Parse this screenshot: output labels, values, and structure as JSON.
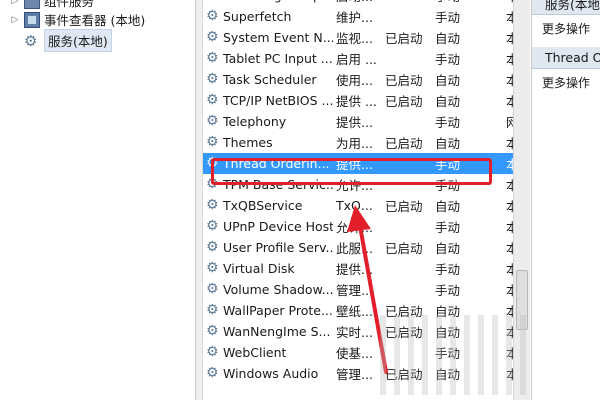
{
  "tree": {
    "items": [
      {
        "label": "组件服务"
      },
      {
        "label": "事件查看器 (本地)"
      },
      {
        "label": "服务(本地)"
      }
    ]
  },
  "services": [
    {
      "name": "Still Image Acqui...",
      "desc": "启动...",
      "status": "",
      "startup": "手动",
      "logon": "本"
    },
    {
      "name": "Superfetch",
      "desc": "维护...",
      "status": "",
      "startup": "手动",
      "logon": "本"
    },
    {
      "name": "System Event N...",
      "desc": "监视...",
      "status": "已启动",
      "startup": "自动",
      "logon": "本"
    },
    {
      "name": "Tablet PC Input ...",
      "desc": "启用 ...",
      "status": "",
      "startup": "手动",
      "logon": "本"
    },
    {
      "name": "Task Scheduler",
      "desc": "使用...",
      "status": "已启动",
      "startup": "自动",
      "logon": "本"
    },
    {
      "name": "TCP/IP NetBIOS ...",
      "desc": "提供 ...",
      "status": "已启动",
      "startup": "自动",
      "logon": "本"
    },
    {
      "name": "Telephony",
      "desc": "提供...",
      "status": "",
      "startup": "手动",
      "logon": "网"
    },
    {
      "name": "Themes",
      "desc": "为用...",
      "status": "已启动",
      "startup": "自动",
      "logon": "本"
    },
    {
      "name": "Thread Orderin...",
      "desc": "提供...",
      "status": "",
      "startup": "手动",
      "logon": "本"
    },
    {
      "name": "TPM Base Servic...",
      "desc": "允许...",
      "status": "",
      "startup": "手动",
      "logon": "本"
    },
    {
      "name": "TxQBService",
      "desc": "TxQ...",
      "status": "已启动",
      "startup": "自动",
      "logon": "本"
    },
    {
      "name": "UPnP Device Host",
      "desc": "允许...",
      "status": "",
      "startup": "手动",
      "logon": "本"
    },
    {
      "name": "User Profile Serv...",
      "desc": "此服...",
      "status": "已启动",
      "startup": "自动",
      "logon": "本"
    },
    {
      "name": "Virtual Disk",
      "desc": "提供...",
      "status": "",
      "startup": "手动",
      "logon": "本"
    },
    {
      "name": "Volume Shadow...",
      "desc": "管理...",
      "status": "",
      "startup": "手动",
      "logon": "本"
    },
    {
      "name": "WallPaper Prote...",
      "desc": "壁纸...",
      "status": "已启动",
      "startup": "自动",
      "logon": "本"
    },
    {
      "name": "WanNengIme S...",
      "desc": "实时...",
      "status": "已启动",
      "startup": "自动",
      "logon": "本"
    },
    {
      "name": "WebClient",
      "desc": "使基...",
      "status": "",
      "startup": "手动",
      "logon": "本"
    },
    {
      "name": "Windows Audio",
      "desc": "管理...",
      "status": "已启动",
      "startup": "自动",
      "logon": "本"
    }
  ],
  "selected_index": 8,
  "actions": {
    "header1": "服务(本地)",
    "item1": "更多操作",
    "header2": "Thread Ordering Server",
    "item2": "更多操作"
  },
  "colors": {
    "selection": "#3399ff",
    "highlight_box": "#e21f2a",
    "arrow": "#e21f2a"
  }
}
